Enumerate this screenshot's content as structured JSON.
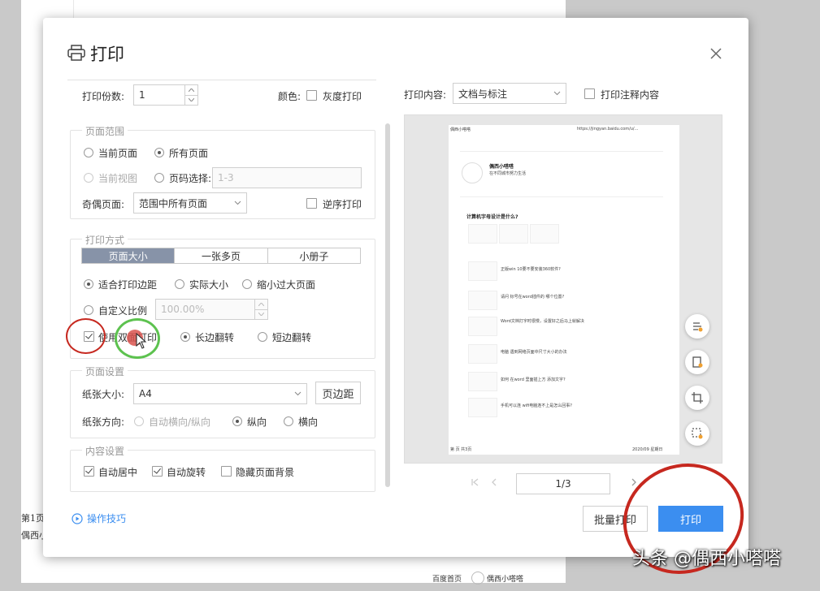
{
  "background": {
    "page_label": "第1页",
    "author_fragment": "偶西小",
    "footer_home": "百度首页",
    "footer_user": "偶西小嗒嗒"
  },
  "dialog": {
    "title": "打印",
    "copies": {
      "label": "打印份数:",
      "value": "1"
    },
    "color": {
      "label": "颜色:",
      "grayscale_label": "灰度打印",
      "grayscale_checked": false
    },
    "page_range": {
      "legend": "页面范围",
      "current_page": "当前页面",
      "all_pages": "所有页面",
      "current_view": "当前视图",
      "page_select_label": "页码选择:",
      "page_select_placeholder": "1-3",
      "odd_even_label": "奇偶页面:",
      "odd_even_value": "范围中所有页面",
      "reverse_label": "逆序打印",
      "selected": "all_pages"
    },
    "print_mode": {
      "legend": "打印方式",
      "tabs": [
        "页面大小",
        "一张多页",
        "小册子"
      ],
      "active_tab": "页面大小",
      "fit_margin": "适合打印边距",
      "actual_size": "实际大小",
      "shrink_large": "缩小过大页面",
      "custom_scale": "自定义比例",
      "custom_scale_value": "100.00%",
      "duplex_label": "使用双面打印",
      "duplex_checked": true,
      "long_edge": "长边翻转",
      "short_edge": "短边翻转",
      "flip_selected": "long_edge"
    },
    "page_setup": {
      "legend": "页面设置",
      "paper_size_label": "纸张大小:",
      "paper_size_value": "A4",
      "margin_button": "页边距",
      "orientation_label": "纸张方向:",
      "auto_orientation": "自动横向/纵向",
      "portrait": "纵向",
      "landscape": "横向",
      "orientation_selected": "portrait"
    },
    "content_setup": {
      "legend": "内容设置",
      "auto_center": "自动居中",
      "auto_rotate": "自动旋转",
      "hide_background": "隐藏页面背景"
    },
    "tips_link": "操作技巧",
    "print_content": {
      "label": "打印内容:",
      "value": "文档与标注"
    },
    "print_annotations_label": "打印注释内容",
    "pager": {
      "value": "1/3"
    },
    "batch_print_button": "批量打印",
    "print_button": "打印"
  },
  "preview_doc": {
    "header_left": "偶西小嗒嗒",
    "header_right": "https://jingyan.baidu.com/u/...",
    "author": "偶西小嗒嗒",
    "subtitle": "在不同城市努力生活",
    "heading": "计算机字母设计是什么?",
    "items": [
      "正版win 10要不要安装360软件?",
      "请问 标号在word插件的 哪个位置?",
      "Word文档打字时很慢，设置好之后马上就解决",
      "电脑 遇到网络页面中尺寸大小的办法",
      "如何 在word 里面插上方 添加文字?",
      "手机可以连 wifi电脑连不上是怎么回事?"
    ],
    "footer_left": "第 页 共3页",
    "footer_right": "2020/09 星期日"
  },
  "watermark": "头条 @偶西小嗒嗒",
  "colors": {
    "primary": "#3b8ef0",
    "tab_active": "#8793a8",
    "annotation": "#c6281f"
  }
}
